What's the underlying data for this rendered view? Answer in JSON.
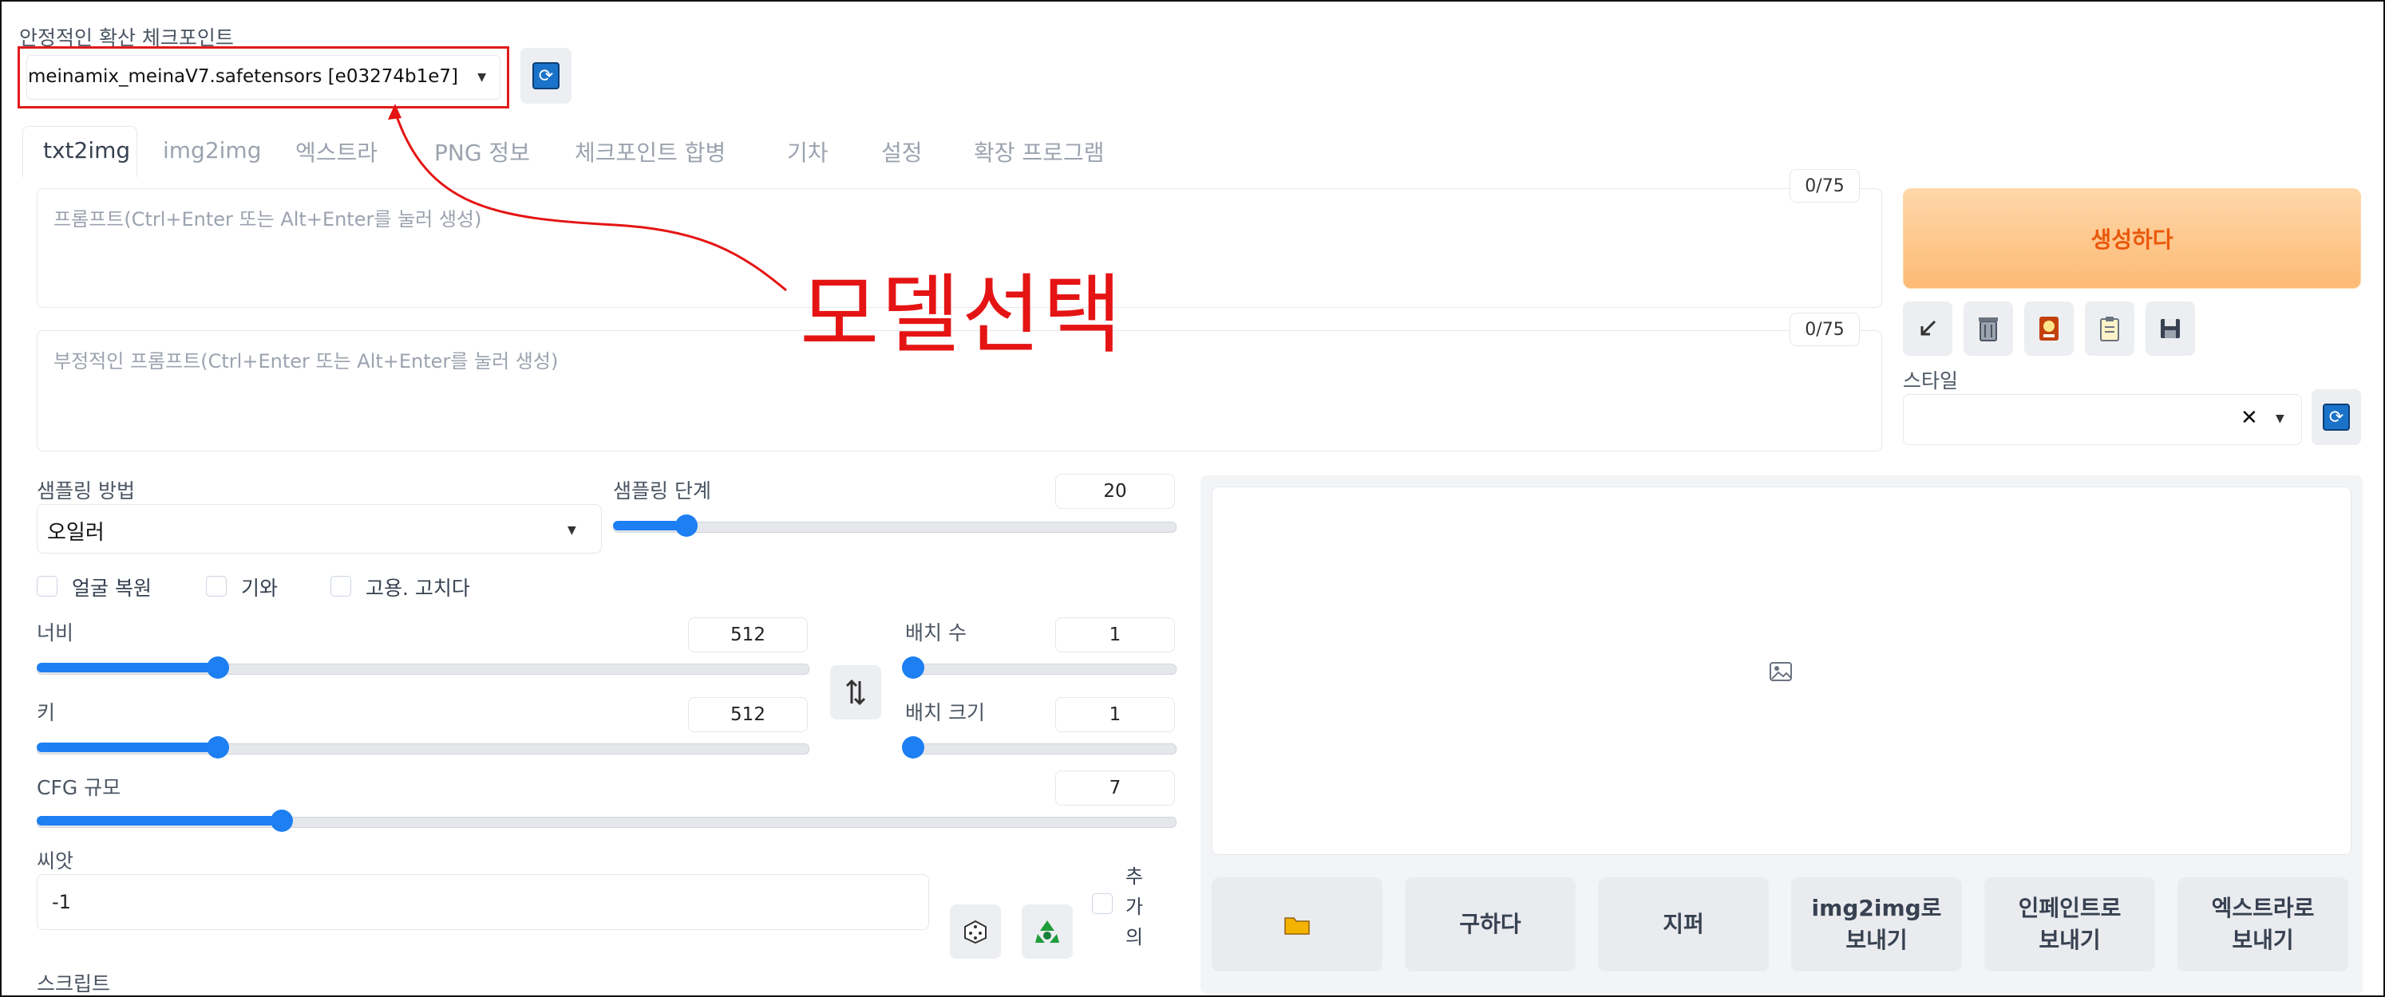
{
  "checkpoint": {
    "label": "안정적인 확산 체크포인트",
    "value": "meinamix_meinaV7.safetensors [e03274b1e7]"
  },
  "tabs": [
    "txt2img",
    "img2img",
    "엑스트라",
    "PNG 정보",
    "체크포인트 합병",
    "기차",
    "설정",
    "확장 프로그램"
  ],
  "prompt": {
    "placeholder": "프롬프트(Ctrl+Enter 또는 Alt+Enter를 눌러 생성)",
    "token_count": "0/75"
  },
  "negative_prompt": {
    "placeholder": "부정적인 프롬프트(Ctrl+Enter 또는 Alt+Enter를 눌러 생성)",
    "token_count": "0/75"
  },
  "annotation": "모델선택",
  "generate_label": "생성하다",
  "styles": {
    "label": "스타일",
    "clear_glyph": "✕"
  },
  "tool_icons": [
    "arrow-icon",
    "trash-icon",
    "card-icon",
    "clipboard-icon",
    "save-icon"
  ],
  "sampler": {
    "label": "샘플링 방법",
    "value": "오일러"
  },
  "steps": {
    "label": "샘플링 단계",
    "value": "20",
    "fraction": 0.13
  },
  "checkboxes": [
    "얼굴 복원",
    "기와",
    "고용. 고치다"
  ],
  "width": {
    "label": "너비",
    "value": "512",
    "fraction": 0.235
  },
  "height": {
    "label": "키",
    "value": "512",
    "fraction": 0.235
  },
  "batch_count": {
    "label": "배치 수",
    "value": "1",
    "fraction": 0.0
  },
  "batch_size": {
    "label": "배치 크기",
    "value": "1",
    "fraction": 0.0
  },
  "cfg": {
    "label": "CFG 규모",
    "value": "7",
    "fraction": 0.215
  },
  "seed": {
    "label": "씨앗",
    "value": "-1",
    "extra_label": [
      "추",
      "가",
      "의"
    ]
  },
  "script_label": "스크립트",
  "output_buttons": [
    "구하다",
    "지퍼",
    "img2img로\n보내기",
    "인페인트로\n보내기",
    "엑스트라로\n보내기"
  ],
  "colors": {
    "accent": "#1d7ff2",
    "annotation": "#e51414",
    "generate_text": "#ea580c"
  }
}
